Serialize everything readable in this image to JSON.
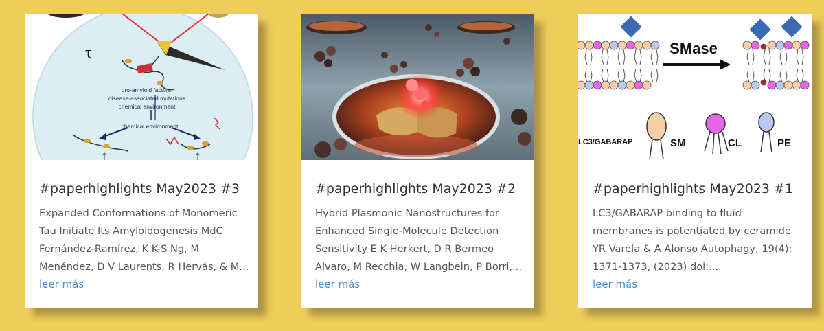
{
  "posts": [
    {
      "title": "#paperhighlights May2023 #3",
      "excerpt_lines": [
        "Expanded Conformations of Monomeric",
        "Tau Initiate Its Amyloidogenesis MdC",
        "Fernández-Ramírez, K K-S Ng, M",
        "Menéndez, D V Laurents, R Hervás, & M..."
      ],
      "read_more": "leer más",
      "image_labels": {
        "tau": "τ",
        "factors_1": "pro-amyloid factors:",
        "factors_2": "disease-associated mutations",
        "factors_3": "chemical environment",
        "env": "chemical environment"
      }
    },
    {
      "title": "#paperhighlights May2023 #2",
      "excerpt_lines": [
        "Hybrid Plasmonic Nanostructures for",
        "Enhanced Single-Molecule Detection",
        "Sensitivity E K Herkert, D R Bermeo",
        "Alvaro, M Recchia, W Langbein, P Borri,..."
      ],
      "read_more": "leer más"
    },
    {
      "title": "#paperhighlights May2023 #1",
      "excerpt_lines": [
        "LC3/GABARAP binding to fluid",
        "membranes is potentiated by ceramide",
        "YR Varela & A Alonso  Autophagy, 19(4):",
        "1371-1373, (2023) doi:..."
      ],
      "read_more": "leer más",
      "image_labels": {
        "enzyme": "SMase",
        "protein": "LC3/GABARAP",
        "sm": "SM",
        "cl": "CL",
        "pe": "PE"
      }
    }
  ],
  "colors": {
    "background": "#f0cd5a",
    "card": "#ffffff",
    "title": "#333333",
    "excerpt": "#555555",
    "link": "#4a8ec9"
  }
}
